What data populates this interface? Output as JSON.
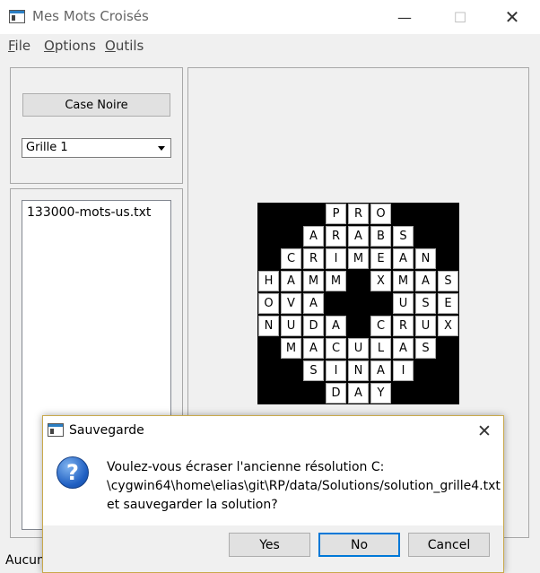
{
  "window": {
    "title": "Mes Mots Croisés"
  },
  "menu": [
    {
      "first": "F",
      "rest": "ile"
    },
    {
      "first": "O",
      "rest": "ptions"
    },
    {
      "first": "O",
      "rest": "utils"
    }
  ],
  "controls": {
    "black_cell_button": "Case Noire",
    "grid_select_value": "Grille 1"
  },
  "files": [
    "133000-mots-us.txt"
  ],
  "status": "Aucun",
  "crossword": {
    "rows": [
      "###PRO###",
      "##ARABS##",
      "#CRIMEAN#",
      "HAMM#XMAS",
      "OVA###USE",
      "NUDA#CRUX",
      "#MACULAS#",
      "##SINAI##",
      "###DAY###"
    ]
  },
  "dialog": {
    "title": "Sauvegarde",
    "message_lines": [
      "Voulez-vous écraser l'ancienne résolution C:",
      "\\cygwin64\\home\\elias\\git\\RP/data/Solutions/solution_grille4.txt",
      "et sauvegarder la solution?"
    ],
    "buttons": {
      "yes": "Yes",
      "no": "No",
      "cancel": "Cancel"
    },
    "default_button_color": "#0078d7"
  }
}
